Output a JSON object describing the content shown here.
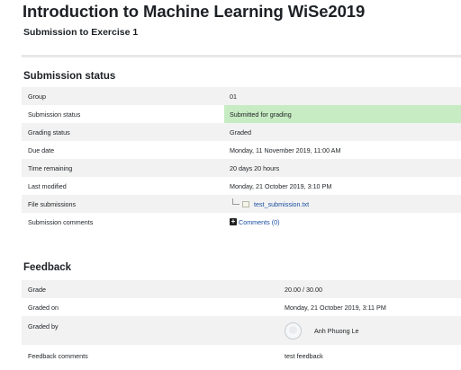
{
  "header": {
    "title": "Introduction to Machine Learning WiSe2019",
    "subtitle": "Submission to Exercise 1"
  },
  "submission_status": {
    "heading": "Submission status",
    "rows": [
      {
        "label": "Group",
        "value": "01"
      },
      {
        "label": "Submission status",
        "value": "Submitted for grading"
      },
      {
        "label": "Grading status",
        "value": "Graded"
      },
      {
        "label": "Due date",
        "value": "Monday, 11 November 2019, 11:00 AM"
      },
      {
        "label": "Time remaining",
        "value": "20 days 20 hours"
      },
      {
        "label": "Last modified",
        "value": "Monday, 21 October 2019, 3:10 PM"
      },
      {
        "label": "File submissions",
        "value": "test_submission.txt"
      },
      {
        "label": "Submission comments",
        "value": "Comments (0)"
      }
    ]
  },
  "feedback": {
    "heading": "Feedback",
    "rows": [
      {
        "label": "Grade",
        "value": "20.00 / 30.00"
      },
      {
        "label": "Graded on",
        "value": "Monday, 21 October 2019, 3:11 PM"
      },
      {
        "label": "Graded by",
        "value": "Anh Phuong Le"
      },
      {
        "label": "Feedback comments",
        "value": "test feedback"
      }
    ]
  },
  "icons": {
    "tree_connector": "tree-connector-icon",
    "file": "file-icon",
    "expand_comments": "plus-square-icon",
    "grader_avatar": "user-avatar-icon"
  },
  "colors": {
    "submitted_highlight": "#c7ecc3",
    "striped_row": "#f2f2f2",
    "link": "#1a4fa0"
  }
}
